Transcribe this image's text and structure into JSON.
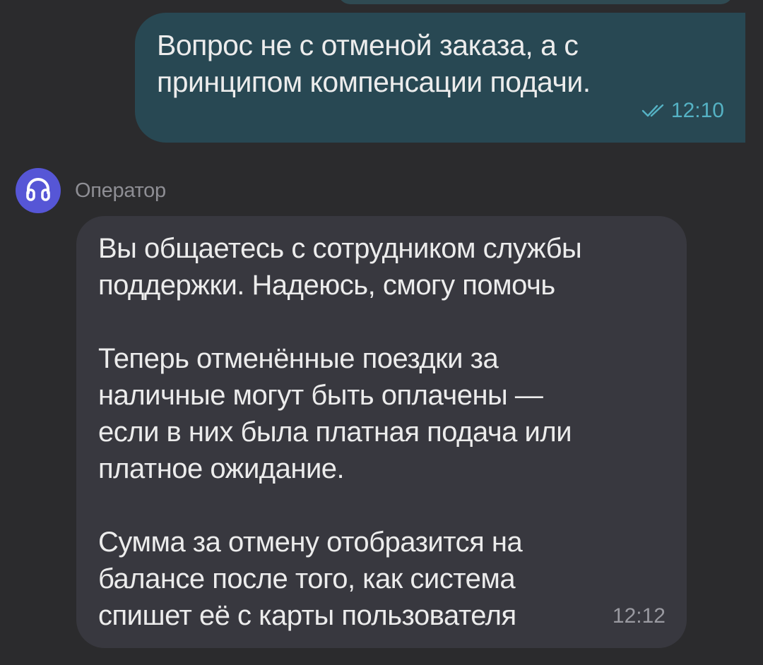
{
  "messages": {
    "outgoing": {
      "text": "Вопрос не с отменой заказа, а с\nпринципом компенсации подачи.",
      "time": "12:10",
      "status_icon": "double-check-icon"
    },
    "incoming": {
      "sender": "Оператор",
      "avatar_icon": "headphones-icon",
      "paragraphs": [
        "Вы общаетесь с сотрудником службы\nподдержки. Надеюсь, смогу помочь",
        "Теперь отменённые поездки за\nналичные могут быть оплачены —\nесли в них была платная подача или\nплатное ожидание.",
        "Сумма за отмену отобразится на\nбалансе после того, как система\nспишет её с карты пользователя"
      ],
      "time": "12:12"
    }
  },
  "colors": {
    "background": "#2b2b2d",
    "outgoing_bubble": "#284853",
    "incoming_bubble": "#38383f",
    "accent": "#55b2c4",
    "avatar": "#5656d6"
  }
}
